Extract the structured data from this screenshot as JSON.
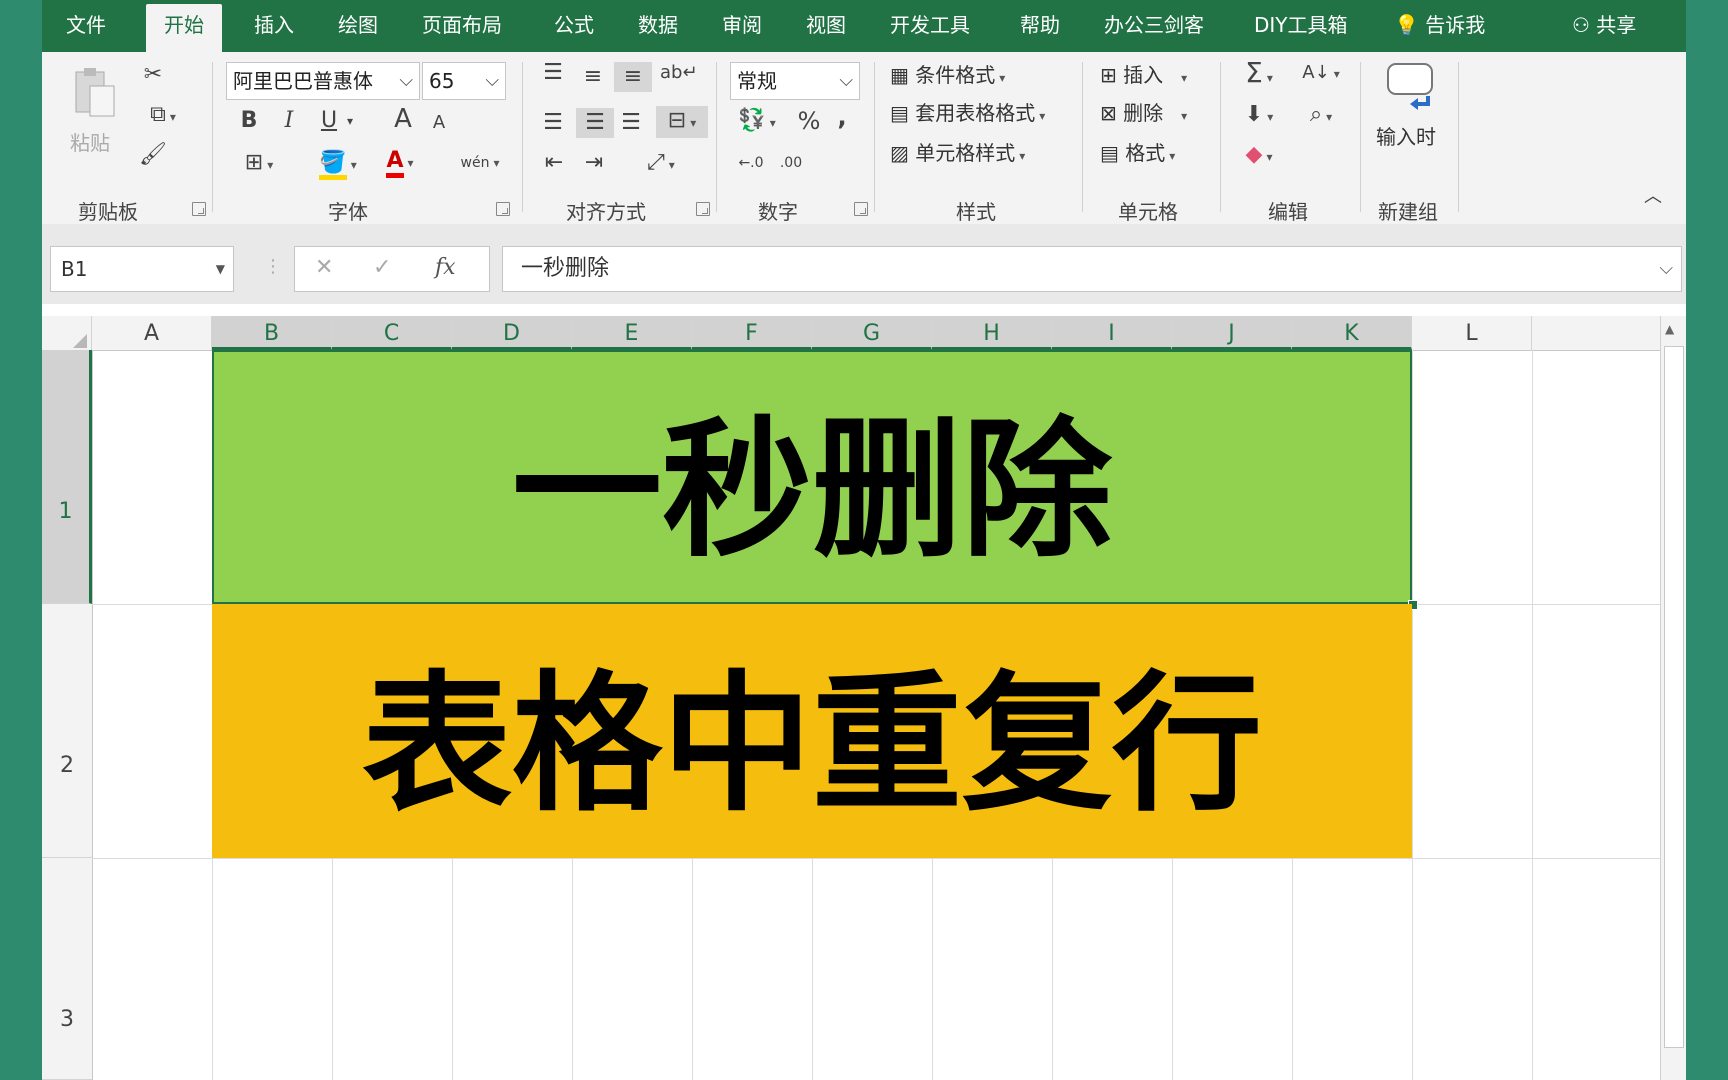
{
  "menu": {
    "tabs": [
      "文件",
      "开始",
      "插入",
      "绘图",
      "页面布局",
      "公式",
      "数据",
      "审阅",
      "视图",
      "开发工具",
      "帮助",
      "办公三剑客",
      "DIY工具箱"
    ],
    "tell_me": "告诉我",
    "share": "共享"
  },
  "ribbon": {
    "clipboard": {
      "paste": "粘贴",
      "group": "剪贴板"
    },
    "font": {
      "name": "阿里巴巴普惠体",
      "size": "65",
      "bold": "B",
      "italic": "I",
      "underline": "U",
      "grow": "A",
      "shrink": "A",
      "font_color": "A",
      "phonetic": "wén",
      "group": "字体"
    },
    "alignment": {
      "group": "对齐方式"
    },
    "number": {
      "format": "常规",
      "percent": "%",
      "comma": ",",
      "inc_decimal": "←.0",
      "dec_decimal": ".00",
      "group": "数字"
    },
    "styles": {
      "conditional": "条件格式",
      "table_format": "套用表格格式",
      "cell_styles": "单元格样式",
      "group": "样式"
    },
    "cells": {
      "insert": "插入",
      "delete": "删除",
      "format": "格式",
      "group": "单元格"
    },
    "editing": {
      "group": "编辑"
    },
    "new_group": {
      "button": "输入时",
      "group": "新建组"
    }
  },
  "formula_bar": {
    "name_box": "B1",
    "fx": "fx",
    "content": "一秒删除"
  },
  "sheet": {
    "columns": [
      "A",
      "B",
      "C",
      "D",
      "E",
      "F",
      "G",
      "H",
      "I",
      "J",
      "K",
      "L"
    ],
    "rows": [
      "1",
      "2",
      "3"
    ],
    "cells": {
      "B1": "一秒删除",
      "B2": "表格中重复行"
    }
  },
  "colors": {
    "green_fill": "#92d050",
    "orange_fill": "#f5bd0e",
    "excel_green": "#217346"
  }
}
